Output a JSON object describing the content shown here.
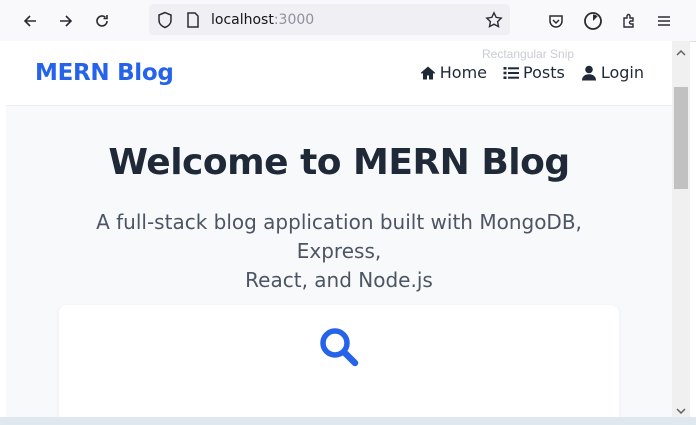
{
  "browser": {
    "url_host": "localhost",
    "url_port": ":3000",
    "icons": [
      "back-icon",
      "forward-icon",
      "reload-icon",
      "shield-icon",
      "page-icon",
      "star-icon",
      "pocket-icon",
      "timer-icon",
      "extensions-icon",
      "menu-icon"
    ]
  },
  "page": {
    "brand": "MERN Blog",
    "nav": [
      {
        "label": "Home",
        "icon": "home-icon"
      },
      {
        "label": "Posts",
        "icon": "list-icon"
      },
      {
        "label": "Login",
        "icon": "user-icon"
      }
    ],
    "ghost_text": "Rectangular Snip",
    "hero_title": "Welcome to MERN Blog",
    "hero_subtitle_line1": "A full-stack blog application built with MongoDB, Express,",
    "hero_subtitle_line2": "React, and Node.js",
    "accent_color": "#2563eb"
  }
}
